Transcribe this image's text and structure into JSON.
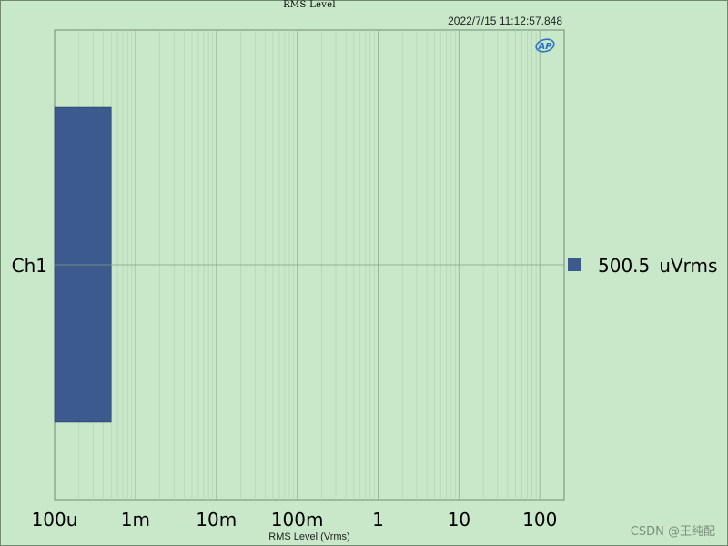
{
  "header": {
    "title": "RMS Level",
    "timestamp": "2022/7/15 11:12:57.848",
    "logo_text": "AP"
  },
  "footer": {
    "watermark": "CSDN @王纯配"
  },
  "colors": {
    "background": "#c9e8c9",
    "bar": "#3d5a8e",
    "grid_major": "#9bb89b",
    "grid_minor": "#b3d3b3",
    "logo": "#2a74c9"
  },
  "chart_data": {
    "type": "bar",
    "orientation": "horizontal",
    "title": "RMS Level",
    "xlabel": "RMS Level (Vrms)",
    "ylabel": "",
    "x_scale": "log",
    "xlim": [
      0.0001,
      200
    ],
    "x_ticks": [
      0.0001,
      0.001,
      0.01,
      0.1,
      1,
      10,
      100
    ],
    "x_tick_labels": [
      "100u",
      "1m",
      "10m",
      "100m",
      "1",
      "10",
      "100"
    ],
    "categories": [
      "Ch1"
    ],
    "series": [
      {
        "name": "Ch1",
        "values": [
          0.0005005
        ]
      }
    ],
    "legend": {
      "placement": "right",
      "entries": [
        {
          "value": "500.5",
          "unit": "uVrms"
        }
      ]
    },
    "grid": true
  }
}
